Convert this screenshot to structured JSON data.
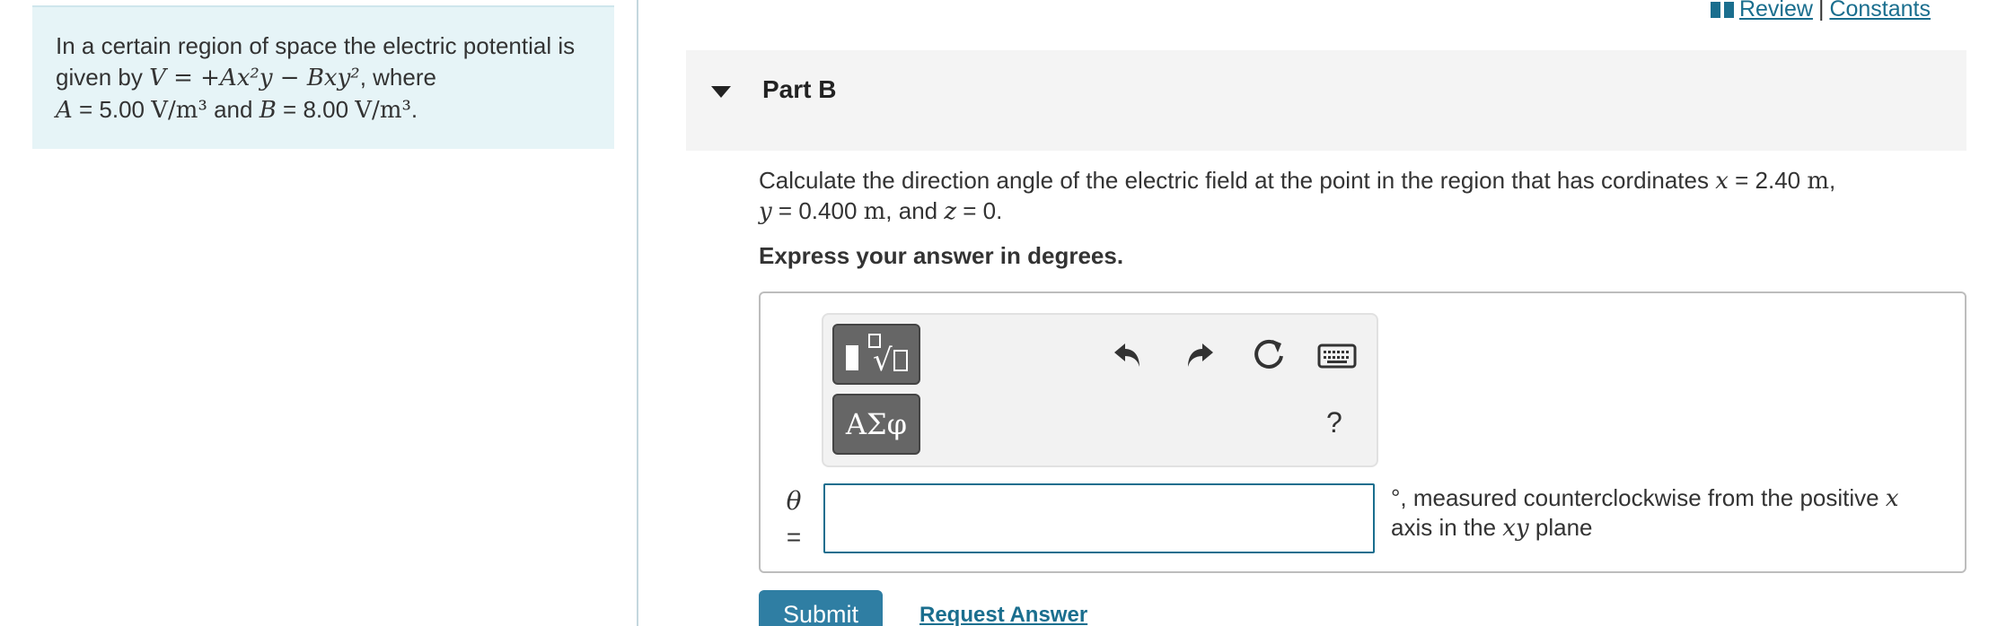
{
  "problem": {
    "line1": "In a certain region of space the electric potential is",
    "given_by": "given by",
    "equation": "V = +Ax²y − Bxy²",
    "where": ", where",
    "A_sym": "A",
    "A_val": " = 5.00 ",
    "A_unit": "V/m³",
    "and": " and ",
    "B_sym": "B",
    "B_val": " = 8.00 ",
    "B_unit": "V/m³",
    "end": "."
  },
  "toplinks": {
    "review": "Review",
    "separator": "|",
    "constants": "Constants"
  },
  "part": {
    "title": "Part B"
  },
  "question": {
    "text1": "Calculate the direction angle of the electric field at the point in the region that has cordinates ",
    "x_sym": "x",
    "x_val": " = 2.40 ",
    "x_unit": "m",
    "comma1": ",",
    "y_sym": "y",
    "y_val": " = 0.400 ",
    "y_unit": "m",
    "and": ", and ",
    "z_sym": "z",
    "z_val": " = 0."
  },
  "instruction": "Express your answer in degrees.",
  "toolbar": {
    "symbols_label": "ΑΣφ",
    "help_label": "?",
    "icons": [
      "templates-icon",
      "undo-icon",
      "redo-icon",
      "reset-icon",
      "keyboard-icon"
    ]
  },
  "answer": {
    "variable": "θ",
    "equals": "=",
    "value": "",
    "unit_prefix": "°, measured counterclockwise from the positive ",
    "unit_x": "x",
    "unit_mid": "axis in the ",
    "unit_xy": "xy",
    "unit_end": " plane"
  },
  "buttons": {
    "submit": "Submit",
    "request": "Request Answer"
  },
  "colors": {
    "accent": "#1a6e8e",
    "submit_bg": "#2f7ea3",
    "problem_bg": "#e6f4f7"
  }
}
